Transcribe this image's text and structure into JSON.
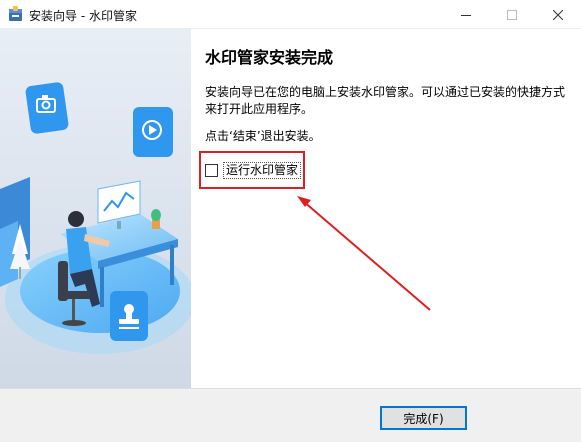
{
  "window": {
    "title": "安装向导 - 水印管家"
  },
  "page": {
    "heading": "水印管家安装完成",
    "description": "安装向导已在您的电脑上安装水印管家。可以通过已安装的快捷方式来打开此应用程序。",
    "hint": "点击‘结束’退出安装。",
    "run_option": {
      "label": "运行水印管家",
      "checked": false
    }
  },
  "footer": {
    "finish_label": "完成(F)"
  },
  "colors": {
    "accent": "#0078d7",
    "annotation": "#e02020",
    "sidebar_bg": "#dfe7f1",
    "illustration_blue": "#3aa0f0"
  },
  "icons": {
    "app": "installer-package-icon",
    "camera": "camera-icon",
    "play": "play-icon",
    "stamp": "stamp-icon"
  }
}
